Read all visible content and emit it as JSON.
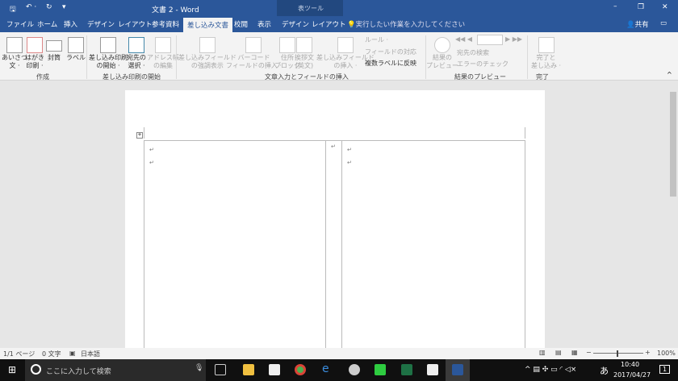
{
  "title": {
    "doc": "文書 2 - Word",
    "table_tools": "表ツール",
    "minimize": "–",
    "restore": "❐",
    "close": "✕"
  },
  "qat": {
    "save": "🖫",
    "undo": "↶ ·",
    "redo": "↻",
    "more": "▾"
  },
  "tabs": [
    "ファイル",
    "ホーム",
    "挿入",
    "デザイン",
    "レイアウト",
    "参考資料",
    "差し込み文書",
    "校閲",
    "表示",
    "デザイン",
    "レイアウト"
  ],
  "tellme": "実行したい作業を入力してください",
  "share": "共有",
  "ribbon": {
    "groups": [
      "作成",
      "差し込み印刷の開始",
      "文章入力とフィールドの挿入",
      "結果のプレビュー",
      "完了"
    ],
    "create": [
      {
        "l1": "あいさつ",
        "l2": "文 ·"
      },
      {
        "l1": "はがき",
        "l2": "印刷 ·"
      },
      {
        "l1": "封筒",
        "l2": ""
      },
      {
        "l1": "ラベル",
        "l2": ""
      }
    ],
    "start": [
      {
        "l1": "差し込み印刷",
        "l2": "の開始 ·"
      },
      {
        "l1": "宛先の",
        "l2": "選択 ·"
      },
      {
        "l1": "アドレス帳",
        "l2": "の編集"
      }
    ],
    "insert": [
      {
        "l1": "差し込みフィールド",
        "l2": "の強調表示"
      },
      {
        "l1": "バーコード",
        "l2": "フィールドの挿入 ·"
      },
      {
        "l1": "住所",
        "l2": "ブロック"
      },
      {
        "l1": "挨拶文",
        "l2": "(英文)"
      },
      {
        "l1": "差し込みフィールド",
        "l2": "の挿入 ·"
      }
    ],
    "insert_small": [
      "ルール ·",
      "フィールドの対応",
      "複数ラベルに反映"
    ],
    "preview": {
      "l1": "結果の",
      "l2": "プレビュー",
      "find": "宛先の検索",
      "check": "エラーのチェック",
      "nav": "◀◀ ◀",
      "nav2": "▶ ▶▶"
    },
    "finish": {
      "l1": "完了と",
      "l2": "差し込み ·"
    }
  },
  "status": {
    "page": "1/1 ページ",
    "words": "0 文字",
    "lang": "日本語",
    "zoom": "100%"
  },
  "taskbar": {
    "search": "ここに入力して検索",
    "time": "10:40",
    "date": "2017/04/27",
    "ime": "あ",
    "notif": "1"
  },
  "colors": {
    "word_blue": "#2b579a"
  }
}
